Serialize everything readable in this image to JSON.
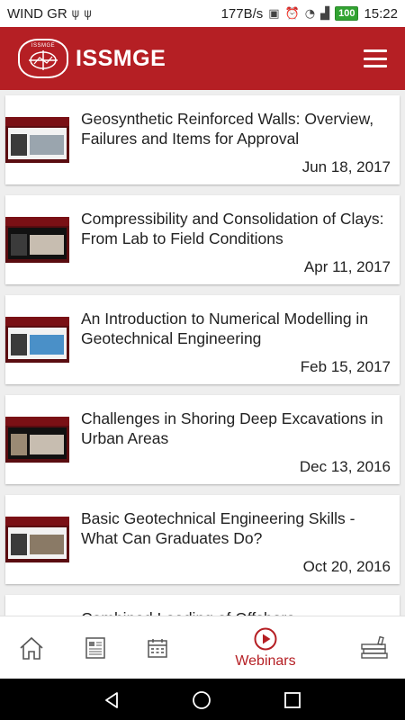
{
  "status_bar": {
    "carrier": "WIND GR",
    "data_rate": "177B/s",
    "battery": "100",
    "time": "15:22"
  },
  "app": {
    "logo_small_text": "ISSMGE",
    "brand": "ISSMGE"
  },
  "webinars": [
    {
      "title": "Geosynthetic Reinforced Walls: Overview, Failures and Items for Approval",
      "date": "Jun 18, 2017",
      "thumb_style": "light"
    },
    {
      "title": "Compressibility and Consolidation of Clays: From Lab to Field Conditions",
      "date": "Apr 11, 2017",
      "thumb_style": "dark"
    },
    {
      "title": "An Introduction to Numerical Modelling in Geotechnical Engineering",
      "date": "Feb 15, 2017",
      "thumb_style": "light"
    },
    {
      "title": "Challenges in Shoring Deep Excavations in Urban Areas",
      "date": "Dec 13, 2016",
      "thumb_style": "dark"
    },
    {
      "title": "Basic Geotechnical Engineering Skills - What Can Graduates Do?",
      "date": "Oct 20, 2016",
      "thumb_style": "light"
    },
    {
      "title": "Combined Loading of Offshore",
      "date": "",
      "thumb_style": "light"
    }
  ],
  "bottom_nav": {
    "items": [
      {
        "icon": "home-icon",
        "label": ""
      },
      {
        "icon": "news-icon",
        "label": ""
      },
      {
        "icon": "calendar-icon",
        "label": ""
      },
      {
        "icon": "play-icon",
        "label": "Webinars",
        "active": true
      },
      {
        "icon": "library-icon",
        "label": ""
      }
    ]
  },
  "colors": {
    "brand_red": "#b51f24",
    "background": "#eeeeee"
  }
}
